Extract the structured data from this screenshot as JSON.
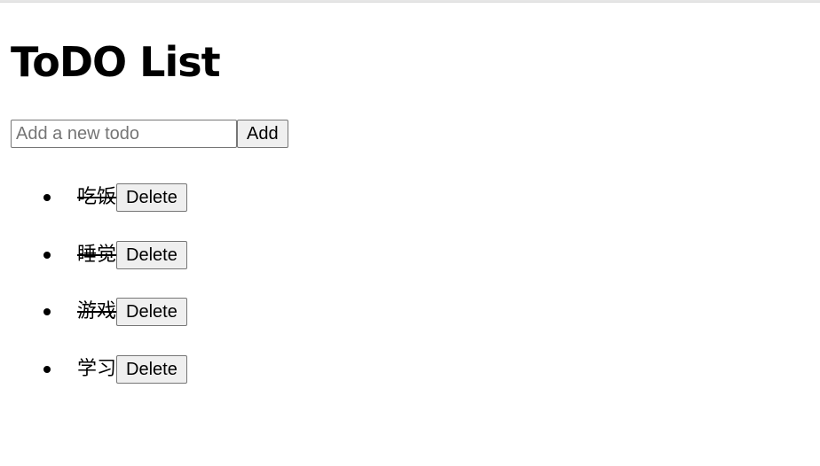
{
  "title": "ToDO List",
  "input": {
    "placeholder": "Add a new todo",
    "value": ""
  },
  "add_label": "Add",
  "todos": [
    {
      "text": "吃饭",
      "completed": true,
      "delete_label": "Delete"
    },
    {
      "text": "睡觉",
      "completed": true,
      "delete_label": "Delete"
    },
    {
      "text": "游戏",
      "completed": true,
      "delete_label": "Delete"
    },
    {
      "text": "学习",
      "completed": false,
      "delete_label": "Delete"
    }
  ]
}
